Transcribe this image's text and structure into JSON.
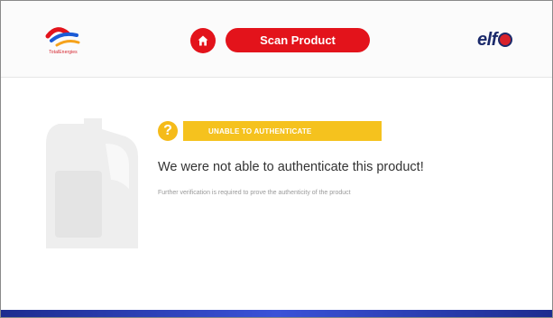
{
  "header": {
    "brand_left_tagline": "TotalEnergies",
    "scan_button_label": "Scan Product",
    "brand_right_logo": "elf",
    "icons": {
      "home": "home-icon"
    }
  },
  "result": {
    "status_label": "UNABLE TO AUTHENTICATE",
    "headline": "We were not able to authenticate this product!",
    "subline": "Further verification is required to prove the authenticity of the product",
    "status_color": "#f5c21e",
    "warning_icon": "?"
  },
  "colors": {
    "accent": "#e3131b",
    "footer": "#2a3fb8"
  }
}
